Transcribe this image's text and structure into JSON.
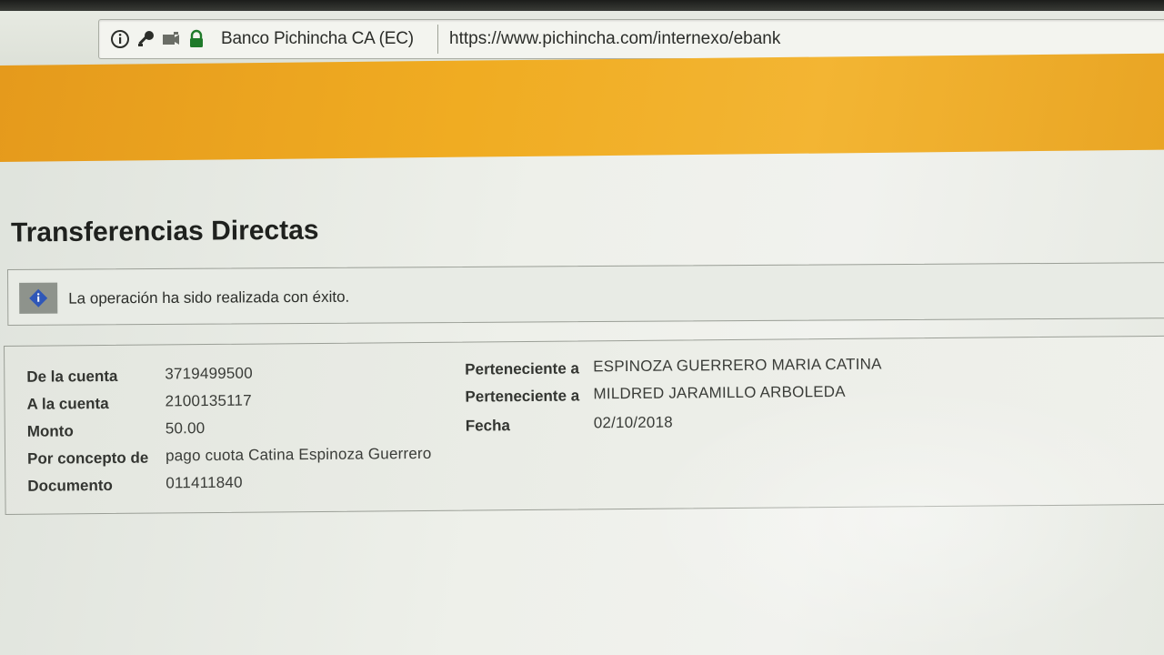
{
  "browser": {
    "site_identity": "Banco Pichincha CA (EC)",
    "url": "https://www.pichincha.com/internexo/ebank",
    "icons": [
      "info-icon",
      "key-icon",
      "camera-icon",
      "lock-icon"
    ]
  },
  "page": {
    "title": "Transferencias Directas",
    "banner_color": "#f0ac22"
  },
  "message": {
    "text": "La operación ha sido realizada con éxito.",
    "icon": "info-diamond-icon",
    "icon_color": "#2f57b8"
  },
  "transfer": {
    "from_account_label": "De la cuenta",
    "from_account": "3719499500",
    "to_account_label": "A la cuenta",
    "to_account": "2100135117",
    "amount_label": "Monto",
    "amount": "50.00",
    "concept_label": "Por concepto de",
    "concept": "pago cuota Catina Espinoza Guerrero",
    "document_label": "Documento",
    "document": "011411840",
    "from_owner_label": "Perteneciente a",
    "from_owner": "ESPINOZA GUERRERO MARIA CATINA",
    "to_owner_label": "Perteneciente a",
    "to_owner": "MILDRED JARAMILLO ARBOLEDA",
    "date_label": "Fecha",
    "date": "02/10/2018"
  }
}
